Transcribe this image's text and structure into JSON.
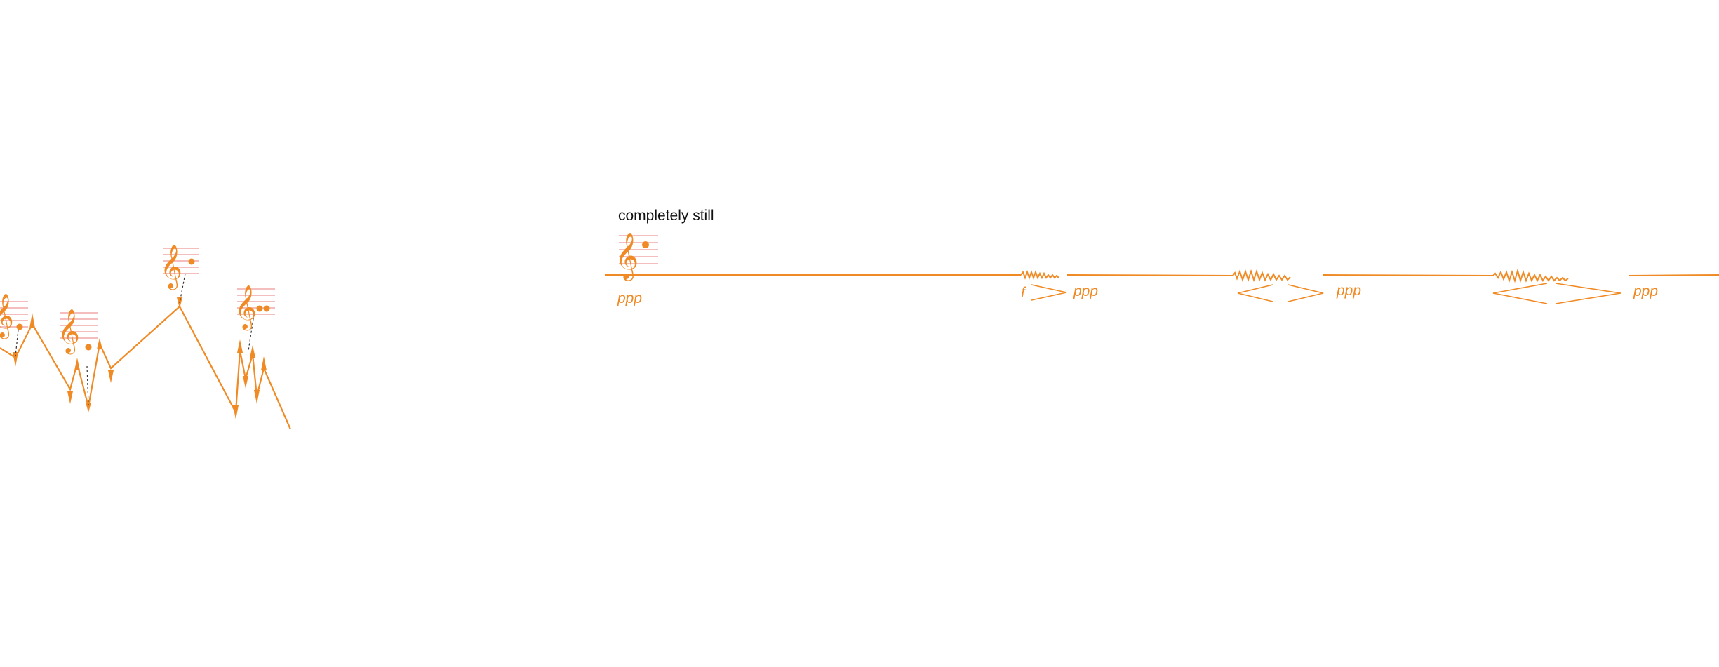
{
  "caption": "completely still",
  "dynamics": {
    "start": "ppp",
    "swell1_start": "f",
    "swell1_end": "ppp",
    "swell2_end": "ppp",
    "swell3_end": "ppp"
  },
  "clef_glyph": "𝄞",
  "colors": {
    "line": "#F08A24",
    "staff": "#F0A8A8",
    "caption": "#111111"
  }
}
